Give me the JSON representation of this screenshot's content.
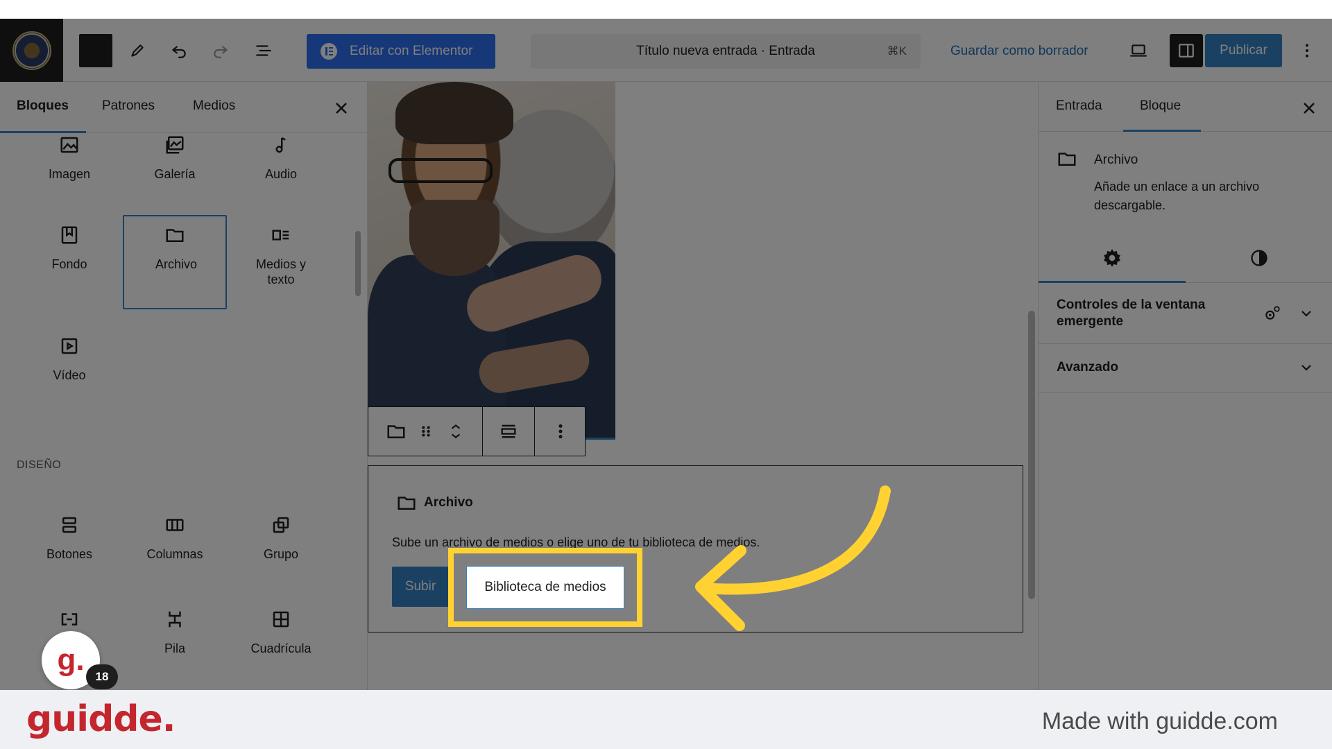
{
  "toolbar": {
    "elementor_label": "Editar con Elementor",
    "doc_title": "Título nueva entrada · Entrada",
    "doc_shortcut": "⌘K",
    "save_draft": "Guardar como borrador",
    "publish": "Publicar",
    "icons": [
      "close-icon",
      "pencil-icon",
      "undo-icon",
      "redo-icon",
      "list-view-icon",
      "desktop-view-icon",
      "sidebar-toggle-icon",
      "more-vertical-icon"
    ]
  },
  "inserter": {
    "tabs": [
      {
        "label": "Bloques",
        "active": true
      },
      {
        "label": "Patrones",
        "active": false
      },
      {
        "label": "Medios",
        "active": false
      }
    ],
    "media_blocks": [
      {
        "label": "Imagen",
        "icon": "image-icon"
      },
      {
        "label": "Galería",
        "icon": "gallery-icon"
      },
      {
        "label": "Audio",
        "icon": "audio-icon"
      },
      {
        "label": "Fondo",
        "icon": "cover-icon"
      },
      {
        "label": "Archivo",
        "icon": "file-folder-icon",
        "selected": true
      },
      {
        "label": "Medios y texto",
        "icon": "media-text-icon"
      },
      {
        "label": "Vídeo",
        "icon": "video-icon"
      }
    ],
    "design_section": "DISEÑO",
    "design_blocks": [
      {
        "label": "Botones",
        "icon": "buttons-icon"
      },
      {
        "label": "Columnas",
        "icon": "columns-icon"
      },
      {
        "label": "Grupo",
        "icon": "group-icon"
      },
      {
        "label": "",
        "icon": "row-icon"
      },
      {
        "label": "Pila",
        "icon": "stack-icon"
      },
      {
        "label": "Cuadrícula",
        "icon": "grid-icon"
      }
    ],
    "guidde_badge": "18",
    "guidde_letter": "g."
  },
  "canvas": {
    "file_block": {
      "title": "Archivo",
      "instructions": "Sube un archivo de medios o elige uno de tu biblioteca de medios.",
      "upload_label": "Subir",
      "library_label": "Biblioteca de medios"
    }
  },
  "settings": {
    "tabs": [
      {
        "label": "Entrada",
        "active": false
      },
      {
        "label": "Bloque",
        "active": true
      }
    ],
    "block_card": {
      "title": "Archivo",
      "description": "Añade un enlace a un archivo descargable."
    },
    "panels": [
      {
        "title": "Controles de la ventana emergente"
      },
      {
        "title": "Avanzado"
      }
    ]
  },
  "footer": {
    "logo": "guidde.",
    "credit": "Made with guidde.com"
  },
  "colors": {
    "accent": "#3582c4",
    "elementor": "#2d6ef0",
    "highlight": "#ffd232",
    "guidde_red": "#c4262e"
  }
}
